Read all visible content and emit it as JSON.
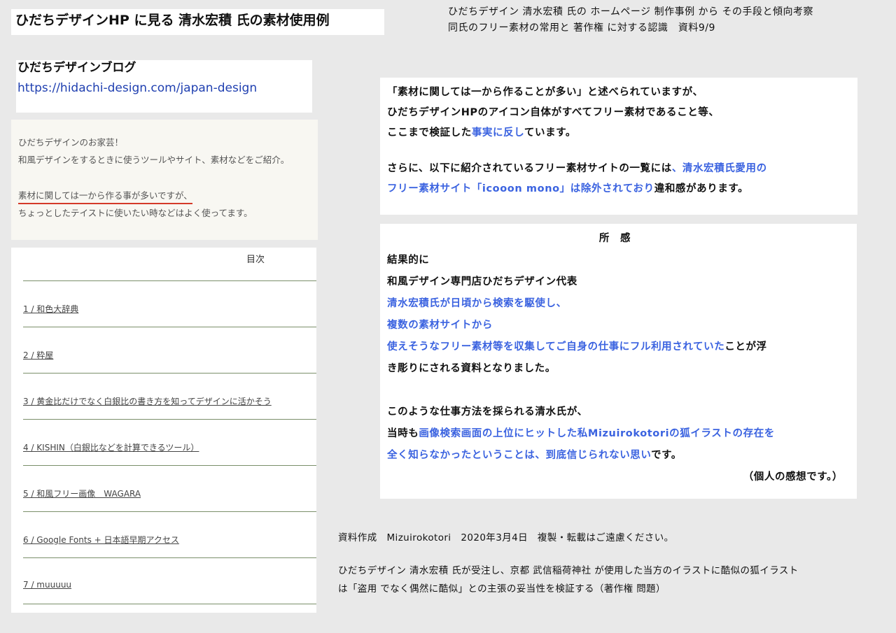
{
  "title": "ひだちデザインHP に見る 清水宏積 氏の素材使用例",
  "header_right": {
    "line1": "ひだちデザイン 清水宏積 氏の ホームページ 制作事例 から その手段と傾向考察",
    "line2": "同氏のフリー素材の常用と 著作権 に対する認識　資料9/9"
  },
  "blog": {
    "name": "ひだちデザインブログ",
    "url": "https://hidachi-design.com/japan-design"
  },
  "quote": {
    "line1": "ひだちデザインのお家芸！",
    "line2": "和風デザインをするときに使うツールやサイト、素材などをご紹介。",
    "line3": "素材に関しては一から作る事が多いですが、",
    "line4": "ちょっとしたテイストに使いたい時などはよく使ってます。"
  },
  "toc": {
    "title": "目次",
    "items": [
      "1 / 和色大辞典",
      "2 / 粋屋",
      "3 / 黄金比だけでなく白銀比の書き方を知ってデザインに活かそう",
      "4 / KISHIN（白銀比などを計算できるツール）",
      "5 / 和風フリー画像　WAGARA",
      "6 / Google Fonts + 日本語早期アクセス",
      "7 / muuuuu"
    ]
  },
  "right_top": {
    "l1": "「素材に関しては一から作ることが多い」と述べられていますが、",
    "l2": "ひだちデザインHPのアイコン自体がすべてフリー素材であること等、",
    "l3a": "ここまで検証した",
    "l3b": "事実に反し",
    "l3c": "ています。",
    "l4a": "さらに、以下に紹介されているフリー素材サイトの一覧には",
    "l4b": "、清水宏積氏愛用の",
    "l5a": "フリー素材サイト「icooon mono」は除外されており",
    "l5b": "違和感があります。"
  },
  "right_mid": {
    "heading": "所　感",
    "l1": "結果的に",
    "l2": "和風デザイン専門店ひだちデザイン代表",
    "l3": "清水宏積氏が日頃から検索を駆使し、",
    "l4": "複数の素材サイトから",
    "l5a": "使えそうなフリー素材等を収集してご自身の仕事にフル利用されていた",
    "l5b": "ことが浮",
    "l6": "き彫りにされる資料となりました。",
    "l7": "このような仕事方法を採られる清水氏が、",
    "l8a": "当時も",
    "l8b": "画像検索画面の上位にヒットした私Mizuirokotoriの狐イラストの存在を",
    "l9a": "全く知らなかったということは、到底信じられない思い",
    "l9b": "です。",
    "closing": "（個人の感想です。）"
  },
  "footer": {
    "credit": "資料作成　Mizuirokotori　2020年3月4日　複製・転載はご遠慮ください。",
    "note1": "ひだちデザイン 清水宏積 氏が受注し、京都 武信稲荷神社 が使用した当方のイラストに酷似の狐イラスト",
    "note2": "は「盗用 でなく偶然に酷似」との主張の妥当性を検証する（著作権 問題）"
  },
  "colors": {
    "background": "#e9e9e9",
    "highlight_blue": "#3b63e0",
    "url_blue": "#1f3fb0",
    "underline_red": "#d43a2a"
  }
}
